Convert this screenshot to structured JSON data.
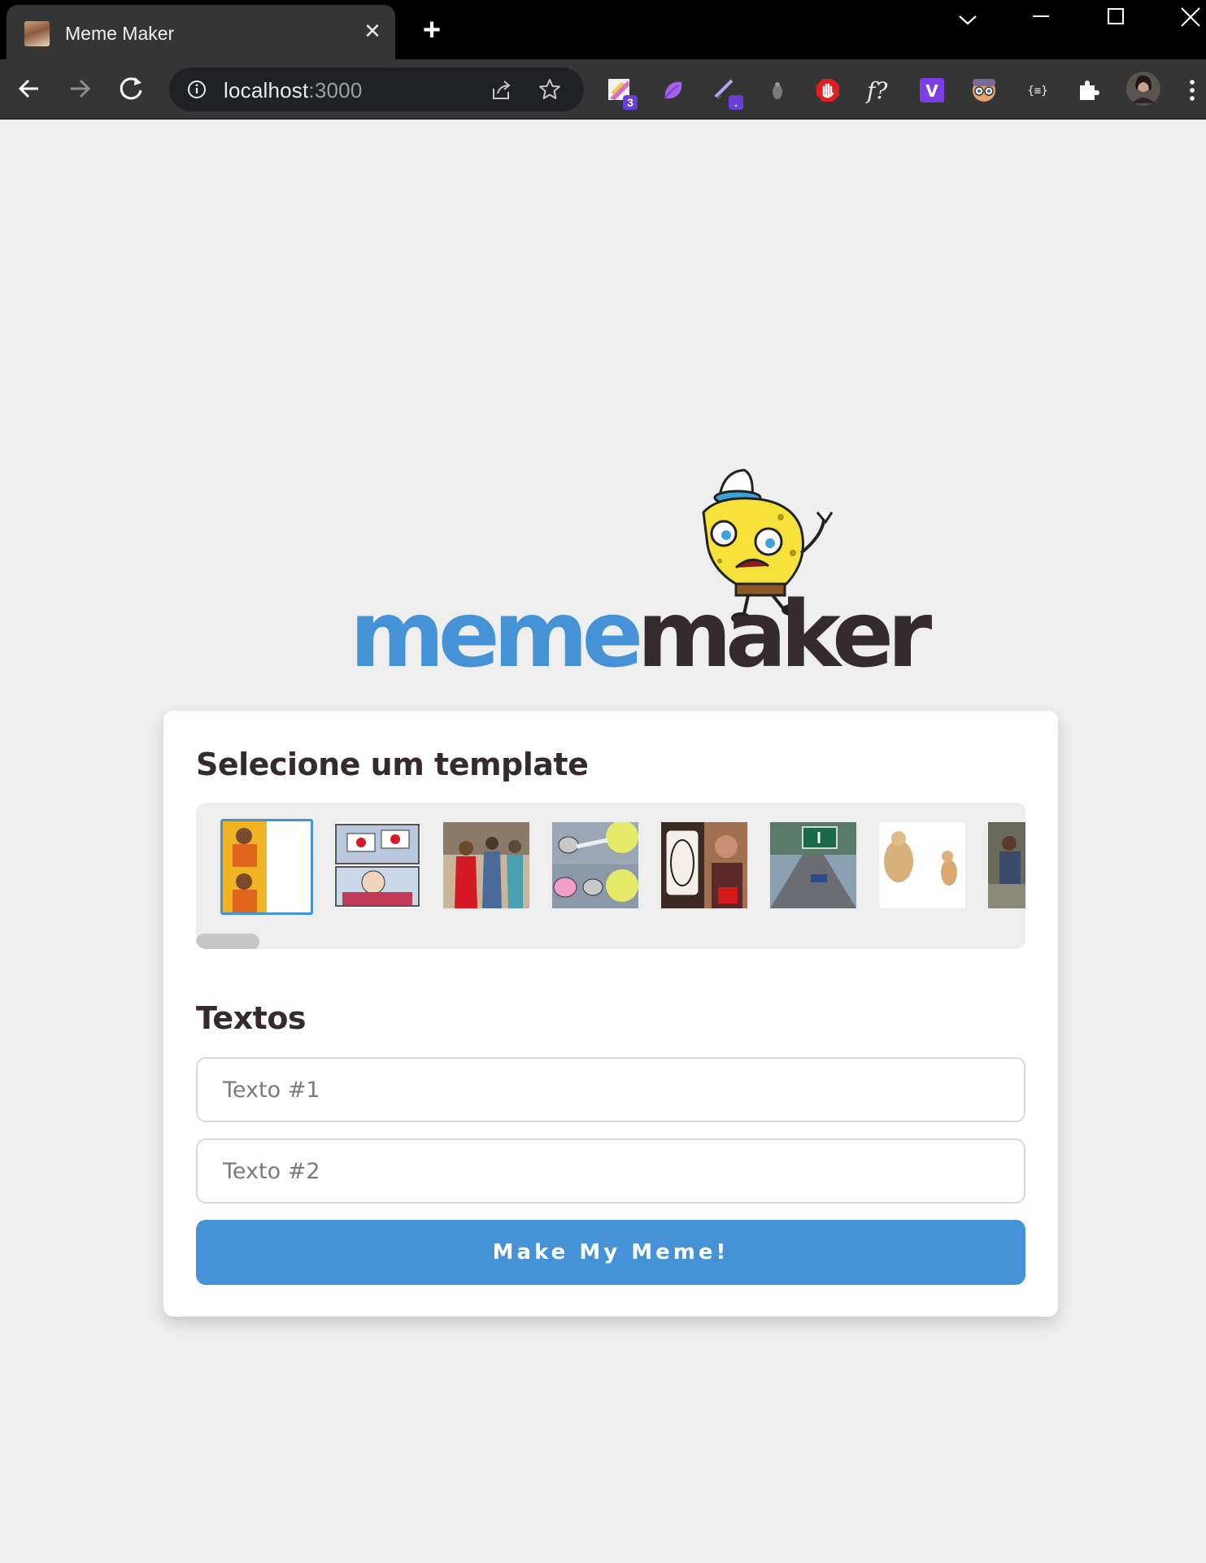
{
  "browser": {
    "tab_title": "Meme Maker",
    "tab_close": "✕",
    "new_tab": "+",
    "url_host": "localhost",
    "url_port": ":3000",
    "extension_badges": {
      "first": "3",
      "third": "."
    }
  },
  "page": {
    "logo": {
      "word_meme": "meme",
      "word_maker": "maker"
    },
    "template_section_title": "Selecione um template",
    "texts_section_title": "Textos",
    "inputs": [
      {
        "placeholder": "Texto #1",
        "value": ""
      },
      {
        "placeholder": "Texto #2",
        "value": ""
      }
    ],
    "submit_label": "Make My Meme!",
    "selected_template_index": 0,
    "templates": [
      {
        "name": "drake-hotline-bling",
        "selected": true
      },
      {
        "name": "two-buttons"
      },
      {
        "name": "distracted-boyfriend"
      },
      {
        "name": "bad-pun-pink-blob"
      },
      {
        "name": "uno-draw-25"
      },
      {
        "name": "left-exit-12-off-ramp"
      },
      {
        "name": "buff-doge-vs-cheems"
      },
      {
        "name": "running-away-balloon"
      }
    ],
    "colors": {
      "accent": "#4593d6",
      "dark_text": "#352a2d",
      "background": "#efefef"
    }
  }
}
